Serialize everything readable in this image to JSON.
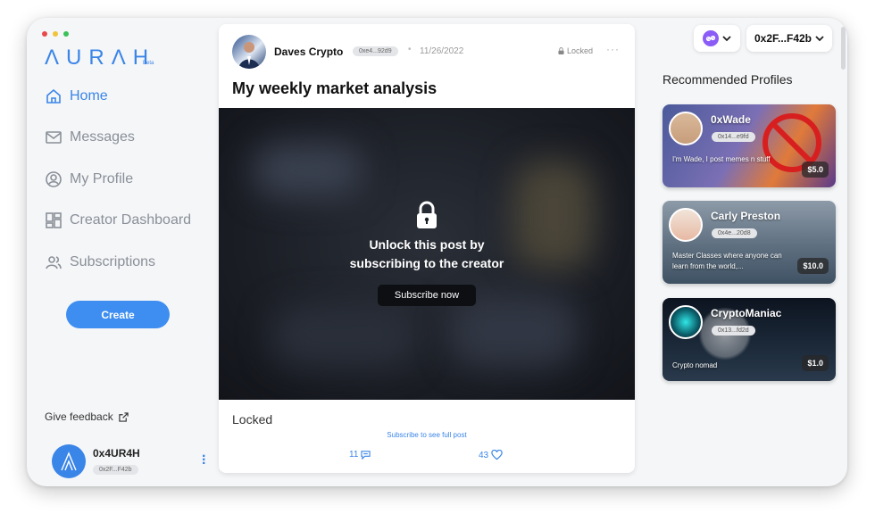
{
  "window": {
    "dots": [
      "#e84a4a",
      "#f1c33a",
      "#3ac15a"
    ]
  },
  "sidebar": {
    "logo": "ΛURΛH",
    "logo_badge": "Beta",
    "nav": [
      {
        "label": "Home",
        "icon": "home-icon",
        "active": true
      },
      {
        "label": "Messages",
        "icon": "mail-icon"
      },
      {
        "label": "My Profile",
        "icon": "user-circle-icon"
      },
      {
        "label": "Creator Dashboard",
        "icon": "dashboard-icon"
      },
      {
        "label": "Subscriptions",
        "icon": "users-icon"
      }
    ],
    "create_label": "Create",
    "feedback_label": "Give feedback",
    "user": {
      "name": "0x4UR4H",
      "address": "0x2F...F42b"
    }
  },
  "post": {
    "author": "Daves Crypto",
    "address": "0xe4...92d9",
    "separator": "•",
    "date": "11/26/2022",
    "status": "Locked",
    "more": "···",
    "title": "My weekly market analysis",
    "unlock_message": "Unlock this post by subscribing to the creator",
    "subscribe_label": "Subscribe now",
    "locked_label": "Locked",
    "see_full_label": "Subscribe to see full post",
    "comments": "11",
    "likes": "43"
  },
  "header": {
    "wallet": "0x2F...F42b",
    "network_icon": "chain-link-icon"
  },
  "recommended": {
    "title": "Recommended Profiles",
    "profiles": [
      {
        "name": "0xWade",
        "address": "0x14...e9fd",
        "bio": "I'm Wade, I post memes n stuff",
        "price": "$5.0"
      },
      {
        "name": "Carly Preston",
        "address": "0x4e...20d8",
        "bio": "Master Classes where anyone can learn from the world,...",
        "price": "$10.0"
      },
      {
        "name": "CryptoManiac",
        "address": "0x13...fd2d",
        "bio": "Crypto nomad",
        "price": "$1.0"
      }
    ]
  },
  "colors": {
    "accent": "#3a85e8",
    "network": "#8b5cf6"
  }
}
